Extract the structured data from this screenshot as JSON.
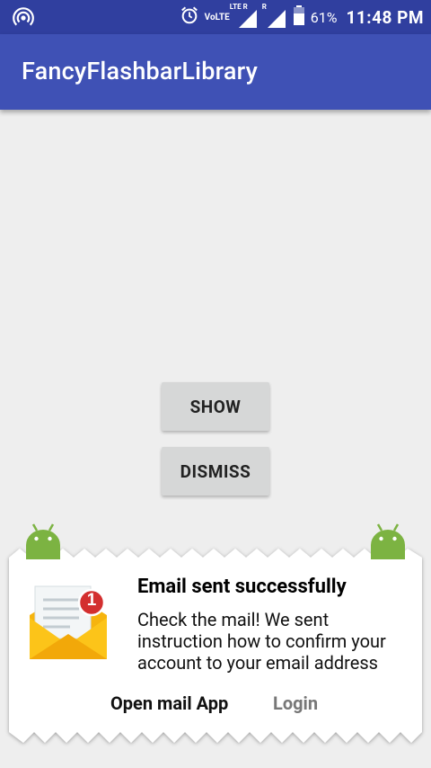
{
  "status_bar": {
    "volte_label": "VoLTE",
    "lte_label": "LTE R",
    "roaming_label": "R",
    "battery_percent": "61%",
    "time": "11:48 PM"
  },
  "app_bar": {
    "title": "FancyFlashbarLibrary",
    "color": "#3f51b5"
  },
  "buttons": {
    "show_label": "SHOW",
    "dismiss_label": "DISMISS"
  },
  "flashbar": {
    "title": "Email sent successfully",
    "message": "Check the mail! We sent instruction how to confirm your account to your email address",
    "positive_action": "Open mail App",
    "negative_action": "Login",
    "icon": "email-notification-icon",
    "notification_count": "1"
  }
}
